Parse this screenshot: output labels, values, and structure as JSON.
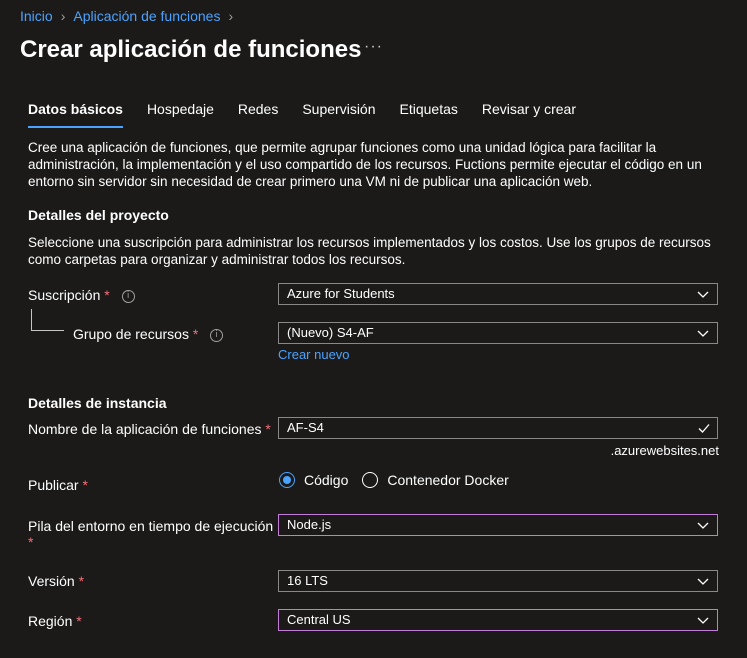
{
  "breadcrumb": {
    "home": "Inicio",
    "current": "Aplicación de funciones"
  },
  "page": {
    "title": "Crear aplicación de funciones",
    "more": "···"
  },
  "tabs": [
    "Datos básicos",
    "Hospedaje",
    "Redes",
    "Supervisión",
    "Etiquetas",
    "Revisar y crear"
  ],
  "intro": "Cree una aplicación de funciones, que permite agrupar funciones como una unidad lógica para facilitar la administración, la implementación y el uso compartido de los recursos. Fuctions permite ejecutar el código en un entorno sin servidor sin necesidad de crear primero una VM ni de publicar una aplicación web.",
  "project": {
    "heading": "Detalles del proyecto",
    "description": "Seleccione una suscripción para administrar los recursos implementados y los costos. Use los grupos de recursos como carpetas para organizar y administrar todos los recursos.",
    "subscription_label": "Suscripción",
    "subscription_value": "Azure for Students",
    "resource_group_label": "Grupo de recursos",
    "resource_group_value": "(Nuevo) S4-AF",
    "create_new": "Crear nuevo"
  },
  "instance": {
    "heading": "Detalles de instancia",
    "name_label": "Nombre de la aplicación de funciones",
    "name_value": "AF-S4",
    "name_suffix": ".azurewebsites.net",
    "publish_label": "Publicar",
    "publish_options": [
      "Código",
      "Contenedor Docker"
    ],
    "publish_selected": "Código",
    "runtime_label": "Pila del entorno en tiempo de ejecución",
    "runtime_value": "Node.js",
    "version_label": "Versión",
    "version_value": "16 LTS",
    "region_label": "Región",
    "region_value": "Central US"
  },
  "required_mark": "*",
  "info_mark": "i",
  "colors": {
    "accent": "#4aa3ff",
    "focus": "#c27bd6",
    "required": "#f1707b",
    "background": "#1b1a19"
  }
}
